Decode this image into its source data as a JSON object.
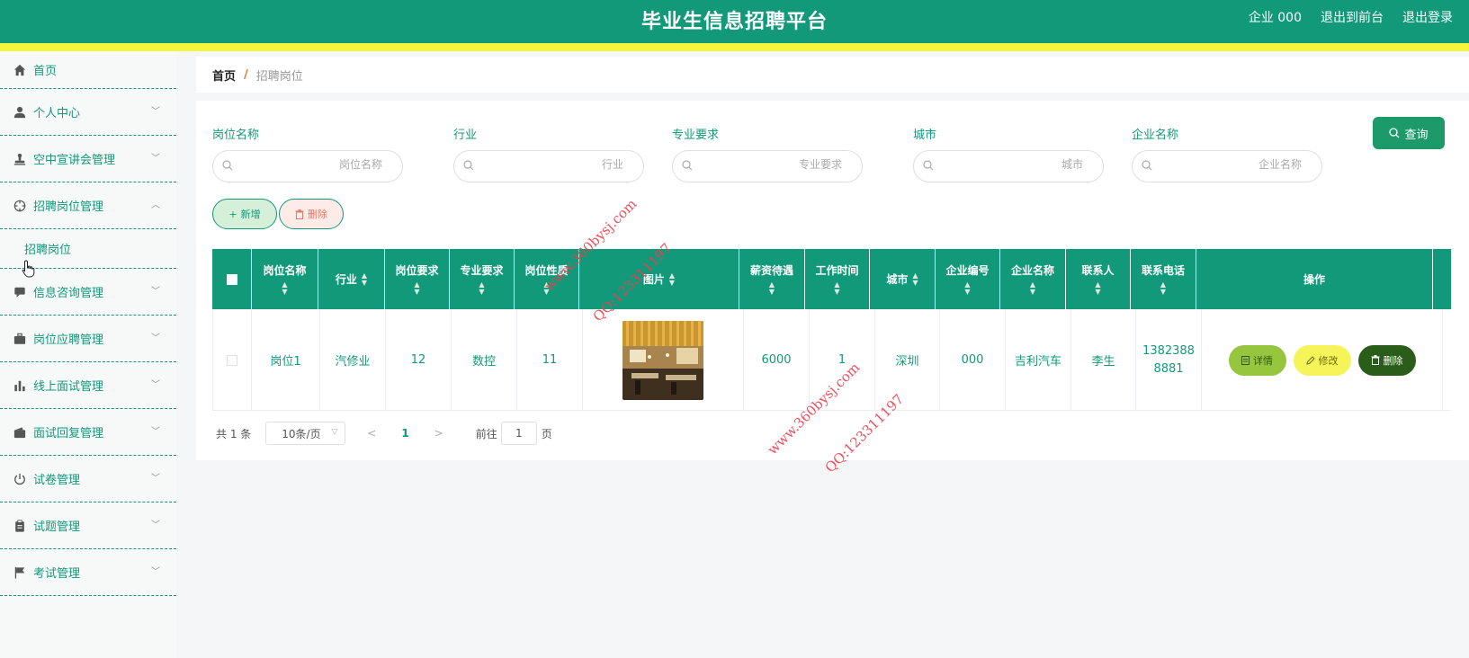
{
  "header": {
    "title": "毕业生信息招聘平台",
    "user": "企业 000",
    "exit_front": "退出到前台",
    "logout": "退出登录"
  },
  "sidebar": {
    "items": [
      {
        "label": "首页",
        "icon": "home-icon"
      },
      {
        "label": "个人中心",
        "icon": "user-icon"
      },
      {
        "label": "空中宣讲会管理",
        "icon": "stamp-icon"
      },
      {
        "label": "招聘岗位管理",
        "icon": "crosshair-icon",
        "expanded": true,
        "children": [
          "招聘岗位"
        ]
      },
      {
        "label": "信息咨询管理",
        "icon": "chat-icon"
      },
      {
        "label": "岗位应聘管理",
        "icon": "briefcase-icon"
      },
      {
        "label": "线上面试管理",
        "icon": "bar-chart-icon"
      },
      {
        "label": "面试回复管理",
        "icon": "wallet-icon"
      },
      {
        "label": "试卷管理",
        "icon": "power-icon"
      },
      {
        "label": "试题管理",
        "icon": "clipboard-icon"
      },
      {
        "label": "考试管理",
        "icon": "flag-icon"
      }
    ]
  },
  "breadcrumb": {
    "home": "首页",
    "sep": "/",
    "current": "招聘岗位"
  },
  "filters": [
    {
      "label": "岗位名称",
      "placeholder": "岗位名称"
    },
    {
      "label": "行业",
      "placeholder": "行业"
    },
    {
      "label": "专业要求",
      "placeholder": "专业要求"
    },
    {
      "label": "城市",
      "placeholder": "城市"
    },
    {
      "label": "企业名称",
      "placeholder": "企业名称"
    }
  ],
  "buttons": {
    "query": "查询",
    "add": "新增",
    "delete": "删除"
  },
  "table": {
    "columns": [
      "岗位名称",
      "行业",
      "岗位要求",
      "专业要求",
      "岗位性质",
      "图片",
      "薪资待遇",
      "工作时间",
      "城市",
      "企业编号",
      "企业名称",
      "联系人",
      "联系电话",
      "操作"
    ],
    "rows": [
      {
        "name": "岗位1",
        "industry": "汽修业",
        "requirement": "12",
        "major": "数控",
        "nature": "11",
        "salary": "6000",
        "work_time": "1",
        "city": "深圳",
        "company_no": "000",
        "company_name": "吉利汽车",
        "contact": "李生",
        "phone_line1": "1382388",
        "phone_line2": "8881"
      }
    ],
    "actions": {
      "detail": "详情",
      "edit": "修改",
      "delete": "删除"
    }
  },
  "pagination": {
    "total": "共 1 条",
    "page_size": "10条/页",
    "current_page": "1",
    "goto_label": "前往",
    "goto_value": "1",
    "goto_unit": "页"
  },
  "watermarks": {
    "site": "www.360bysj.com",
    "qq": "QQ:123311197"
  },
  "colors": {
    "primary": "#12997a",
    "stripe": "#f4f63c",
    "detail": "#95c63d",
    "edit": "#f5f55a",
    "danger": "#2b5d1a",
    "watermark": "#ef3d4c"
  }
}
